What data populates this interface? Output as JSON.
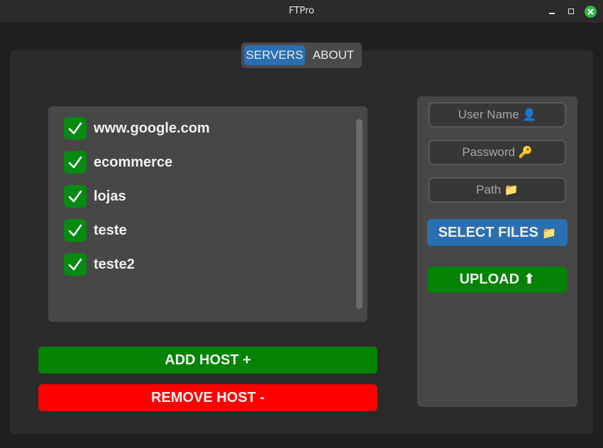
{
  "window": {
    "title": "FTPro"
  },
  "tabs": [
    {
      "label": "SERVERS",
      "active": true
    },
    {
      "label": "ABOUT",
      "active": false
    }
  ],
  "hosts": [
    {
      "label": "www.google.com",
      "checked": true
    },
    {
      "label": "ecommerce",
      "checked": true
    },
    {
      "label": "lojas",
      "checked": true
    },
    {
      "label": "teste",
      "checked": true
    },
    {
      "label": "teste2",
      "checked": true
    }
  ],
  "buttons": {
    "add_host": "ADD HOST +",
    "remove_host": "REMOVE HOST -",
    "select_files": "SELECT FILES",
    "upload": "UPLOAD"
  },
  "fields": {
    "username_placeholder": "User Name",
    "password_placeholder": "Password",
    "path_placeholder": "Path"
  },
  "icons": {
    "user": "👤",
    "key": "🔑",
    "folder": "📁",
    "upload_arrow": "⬆"
  },
  "colors": {
    "accent_blue": "#2a6fb0",
    "green": "#048305",
    "red": "#fe0000"
  }
}
